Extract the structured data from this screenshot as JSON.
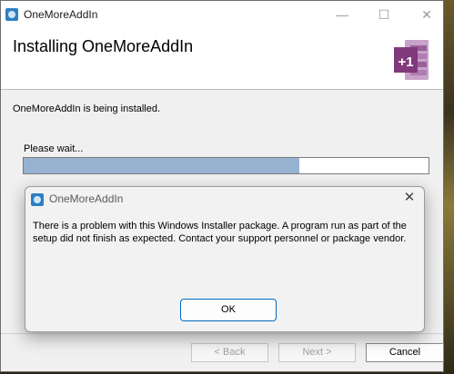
{
  "window": {
    "title": "OneMoreAddIn",
    "controls": {
      "minimize": "—",
      "maximize": "☐",
      "close": "✕"
    }
  },
  "header": {
    "title": "Installing OneMoreAddIn",
    "logo_text": "+1"
  },
  "body": {
    "status": "OneMoreAddIn is being installed.",
    "wait_label": "Please wait...",
    "progress": 0.68
  },
  "footer": {
    "back_label": "< Back",
    "next_label": "Next >",
    "cancel_label": "Cancel"
  },
  "dialog": {
    "title": "OneMoreAddIn",
    "message": "There is a problem with this Windows Installer package. A program run as part of the setup did not finish as expected. Contact your support personnel or package vendor.",
    "ok_label": "OK",
    "close_glyph": "✕"
  },
  "colors": {
    "progress_fill": "#97b2d0",
    "accent": "#0067c0",
    "logo_purple": "#80397b"
  }
}
